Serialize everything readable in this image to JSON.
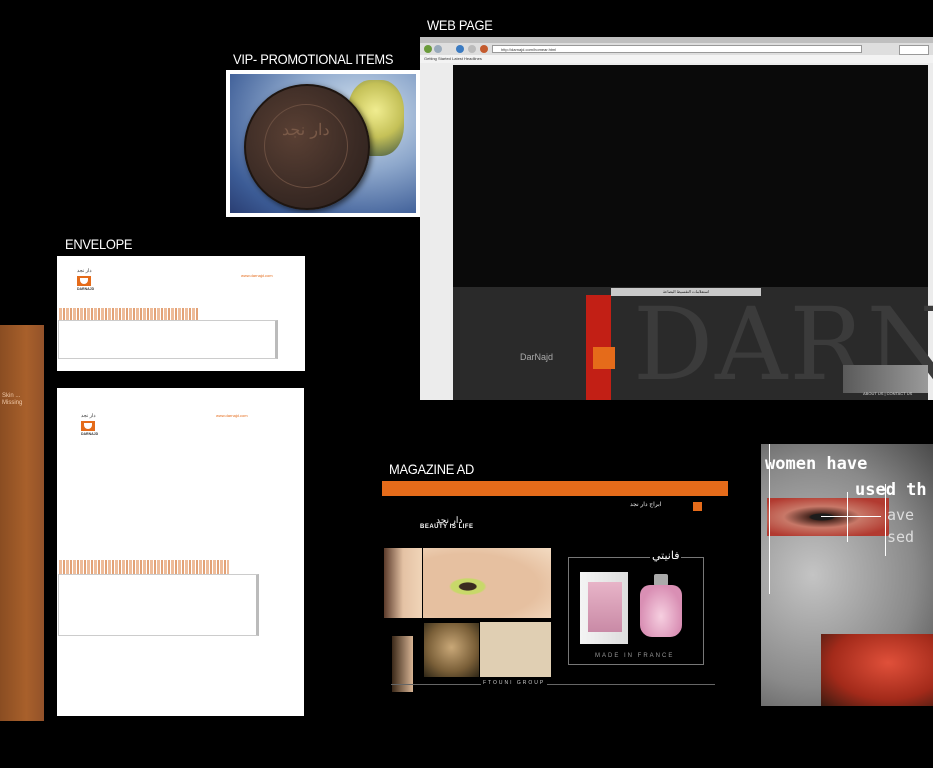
{
  "labels": {
    "web_page": "WEB PAGE",
    "promotional": "VIP- PROMOTIONAL ITEMS",
    "envelope": "ENVELOPE",
    "magazine": "MAGAZINE AD"
  },
  "brand": {
    "arabic": "دار نجد",
    "english": "DARNAJD",
    "url": "www.darnajd.com"
  },
  "brochure": {
    "text": "Skin ... Missing"
  },
  "browser": {
    "url": "http://darnajd.com/homear.html",
    "bookmarks": "Getting Started   Latest Headlines",
    "menu": "استعلامات   التقسيط   البضاعة",
    "hero": "DARN",
    "site_name": "DarNajd",
    "footer": "ABOUT US | CONTACT US"
  },
  "magazine": {
    "header_ar": "ابراج دار نجد",
    "brand_tagline": "BEAUTY IS LIFE",
    "perfume_name": "فانيتي",
    "made_in": "MADE IN FRANCE",
    "group": "FTOUNI GROUP"
  },
  "poster": {
    "line1": "women have",
    "line2": "used th",
    "line3": "ave",
    "line4": "sed"
  },
  "colors": {
    "accent": "#e56b1a",
    "background": "#000000"
  }
}
